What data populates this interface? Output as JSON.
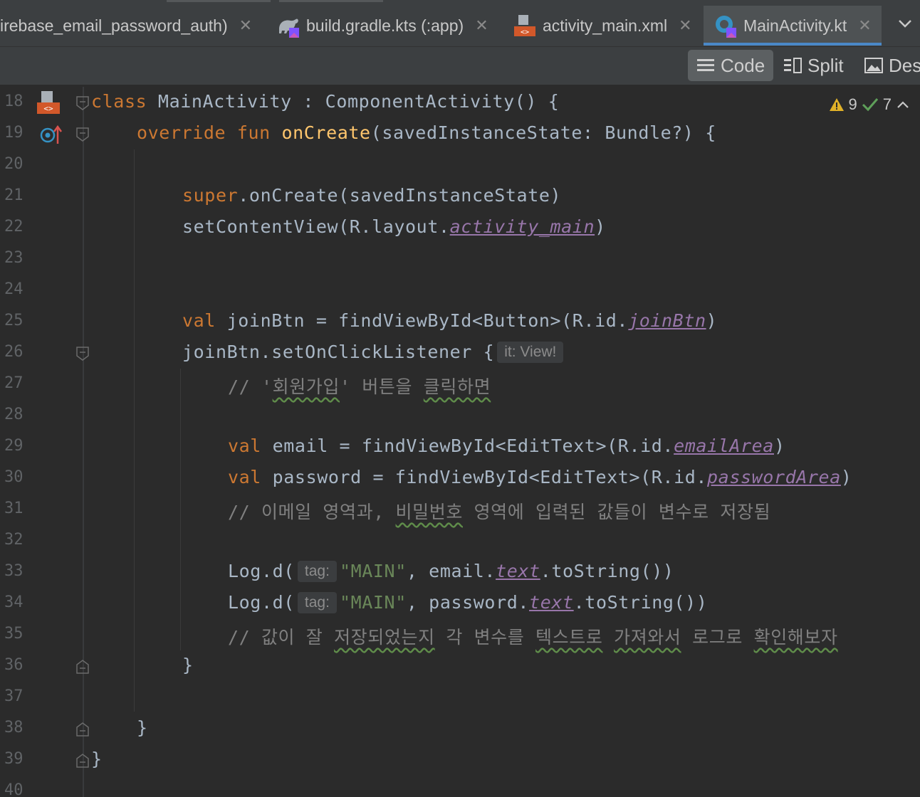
{
  "tabs": [
    {
      "label": "irebase_email_password_auth)",
      "icon": "gradle-icon"
    },
    {
      "label": "build.gradle.kts (:app)",
      "icon": "gradle-kts-icon"
    },
    {
      "label": "activity_main.xml",
      "icon": "xml-layout-icon"
    },
    {
      "label": "MainActivity.kt",
      "icon": "kotlin-class-icon",
      "active": true
    }
  ],
  "modes": {
    "code": "Code",
    "split": "Split",
    "design": "Des"
  },
  "inspections": {
    "warnings": "9",
    "weak_warnings": "7"
  },
  "lines": {
    "18": "18",
    "19": "19",
    "20": "20",
    "21": "21",
    "22": "22",
    "23": "23",
    "24": "24",
    "25": "25",
    "26": "26",
    "27": "27",
    "28": "28",
    "29": "29",
    "30": "30",
    "31": "31",
    "32": "32",
    "33": "33",
    "34": "34",
    "35": "35",
    "36": "36",
    "37": "37",
    "38": "38",
    "39": "39",
    "40": "40"
  },
  "code": {
    "l18": {
      "kw": "class",
      "name": " MainActivity : ComponentActivity() {"
    },
    "l19": {
      "kw": "override fun ",
      "fn": "onCreate",
      "rest": "(savedInstanceState: Bundle?) {"
    },
    "l21": {
      "kw": "super",
      "rest": ".onCreate(savedInstanceState)"
    },
    "l22": {
      "pre": "setContentView(R.layout.",
      "prop": "activity_main",
      "post": ")"
    },
    "l25": {
      "kw": "val",
      "pre": " joinBtn = findViewById<Button>(R.id.",
      "prop": "joinBtn",
      "post": ")"
    },
    "l26": {
      "pre": "joinBtn.setOnClickListener {",
      "hint": "it: View!"
    },
    "l27": {
      "c1": "// '",
      "c2": "회원가입",
      "c3": "' 버튼을 ",
      "c4": "클릭하면"
    },
    "l29": {
      "kw": "val",
      "pre": " email = findViewById<EditText>(R.id.",
      "prop": "emailArea",
      "post": ")"
    },
    "l30": {
      "kw": "val",
      "pre": " password = findViewById<EditText>(R.id.",
      "prop": "passwordArea",
      "post": ")"
    },
    "l31": {
      "c1": "// 이메일 영역과, ",
      "c2": "비밀번호",
      "c3": " 영역에 입력된 값들이 변수로 저장됨"
    },
    "l33": {
      "pre": "Log.d(",
      "hint": "tag:",
      "str": "\"MAIN\"",
      "mid": ", email.",
      "prop": "text",
      "post": ".toString())"
    },
    "l34": {
      "pre": "Log.d(",
      "hint": "tag:",
      "str": "\"MAIN\"",
      "mid": ", password.",
      "prop": "text",
      "post": ".toString())"
    },
    "l35": {
      "c1": "// 값이 잘 ",
      "c2": "저장되었는지",
      "c3": " 각 변수를 ",
      "c4": "텍스트로",
      "c5": " ",
      "c6": "가져와서",
      "c7": " 로그로 ",
      "c8": "확인해보자"
    },
    "l36": "}",
    "l38": "}",
    "l39": "}"
  },
  "colors": {
    "keyword": "#cc7832",
    "function": "#ffc66d",
    "string": "#6a8759",
    "comment": "#808080",
    "property": "#9876aa",
    "accent": "#4a88c7"
  }
}
